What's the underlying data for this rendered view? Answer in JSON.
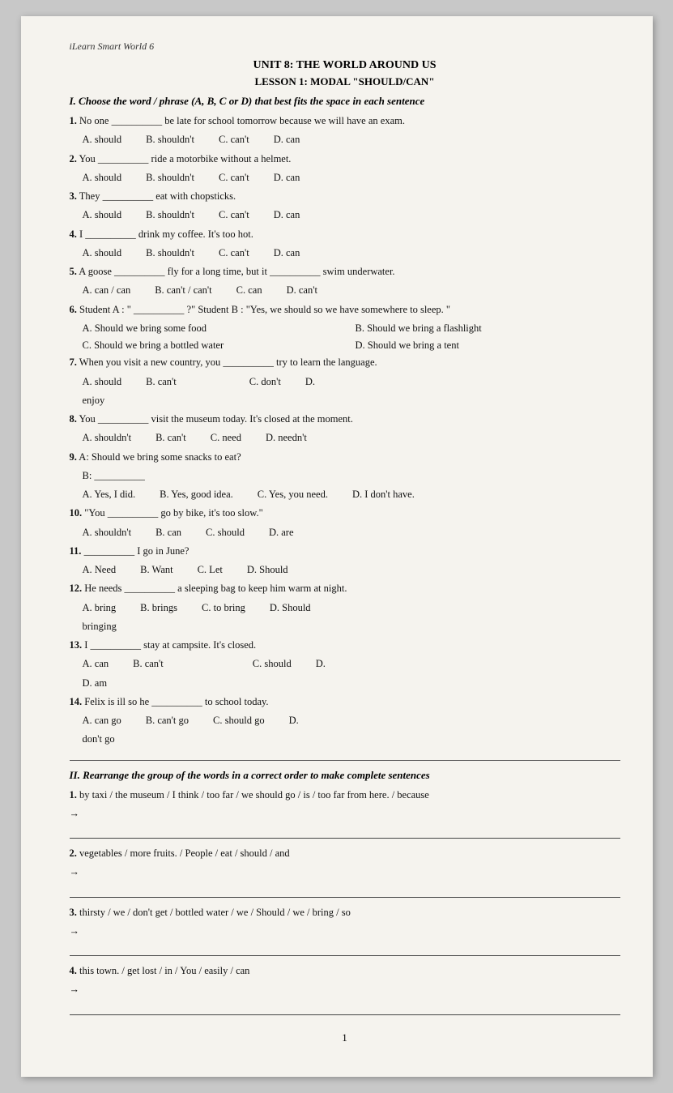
{
  "app_title": "iLearn Smart World 6",
  "unit_title": "UNIT 8: THE WORLD AROUND US",
  "lesson_title": "LESSON 1: MODAL \"SHOULD/CAN\"",
  "section_i_title": "I. Choose the word / phrase (A, B, C or D) that best fits the space in each sentence",
  "questions": [
    {
      "num": "1.",
      "text": "No one __________ be late for school tomorrow because we will have an exam.",
      "options": [
        "A. should",
        "B. shouldn't",
        "C. can't",
        "D. can"
      ]
    },
    {
      "num": "2.",
      "text": "You __________ ride a motorbike without a helmet.",
      "options": [
        "A. should",
        "B. shouldn't",
        "C. can't",
        "D. can"
      ]
    },
    {
      "num": "3.",
      "text": "They __________ eat with chopsticks.",
      "options": [
        "A. should",
        "B. shouldn't",
        "C. can't",
        "D. can"
      ]
    },
    {
      "num": "4.",
      "text": "I __________ drink my coffee. It's too hot.",
      "options": [
        "A. should",
        "B. shouldn't",
        "C. can't",
        "D. can"
      ]
    },
    {
      "num": "5.",
      "text": "A goose __________ fly for a long time, but it __________ swim underwater.",
      "options": [
        "A. can / can",
        "B. can't / can't",
        "C. can",
        "D. can't"
      ]
    },
    {
      "num": "6.",
      "text": "Student A : \" __________ ?\" Student B : \"Yes, we should so we have somewhere to sleep. \"",
      "options_two_col": [
        "A. Should we bring some food",
        "B. Should we bring a flashlight",
        "C. Should we bring a bottled water",
        "D. Should we bring a tent"
      ]
    },
    {
      "num": "7.",
      "text": "When you visit a new country, you __________ try to learn the language.",
      "options": [
        "A. should",
        "B. can't",
        "C. don't",
        "D."
      ]
    },
    {
      "num": "8.",
      "text": "You __________ visit the museum today. It's closed at the moment.",
      "options": [
        "A. shouldn't",
        "B. can't",
        "C. need",
        "D. needn't"
      ]
    },
    {
      "num": "9.",
      "text": "A: Should we bring some snacks to eat?",
      "text2": "B: __________",
      "options": [
        "A. Yes, I did.",
        "B. Yes, good idea.",
        "C. Yes, you need.",
        "D. I don't have."
      ]
    },
    {
      "num": "10.",
      "text": "\"You __________ go by bike, it's too slow.\"",
      "options": [
        "A. shouldn't",
        "B. can",
        "C. should",
        "D. are"
      ]
    },
    {
      "num": "11.",
      "text": "__________ I go in June?",
      "options": [
        "A. Need",
        "B. Want",
        "C. Let",
        "D. Should"
      ]
    },
    {
      "num": "12.",
      "text": "He needs __________ a sleeping bag to keep him warm at night.",
      "options": [
        "A. bring",
        "B. brings",
        "C. to bring",
        "D."
      ]
    },
    {
      "num": "13.",
      "extra_label": "bringing",
      "text": "I __________ stay at campsite. It's closed.",
      "options": [
        "A. can",
        "B. can't",
        "C. should",
        "D."
      ]
    },
    {
      "num": "",
      "extra": "D. am",
      "text": ""
    },
    {
      "num": "14.",
      "text": "Felix is ill so he __________ to school today.",
      "options": [
        "A. can go",
        "B. can't go",
        "C. should go",
        "D."
      ]
    },
    {
      "num": "",
      "extra": "don't go",
      "text": ""
    }
  ],
  "section_ii_title": "II. Rearrange the group of the words in a correct order to make complete sentences",
  "rearrange": [
    {
      "num": "1.",
      "words": "by taxi / the museum / I think / too far / we should go / is / too far from here. / because"
    },
    {
      "num": "2.",
      "words": "vegetables / more fruits. / People / eat / should / and"
    },
    {
      "num": "3.",
      "words": "thirsty / we / don't get / bottled water / we / Should / we / bring / so"
    },
    {
      "num": "4.",
      "words": "this town. / get lost / in / You / easily / can"
    }
  ],
  "page_number": "1"
}
